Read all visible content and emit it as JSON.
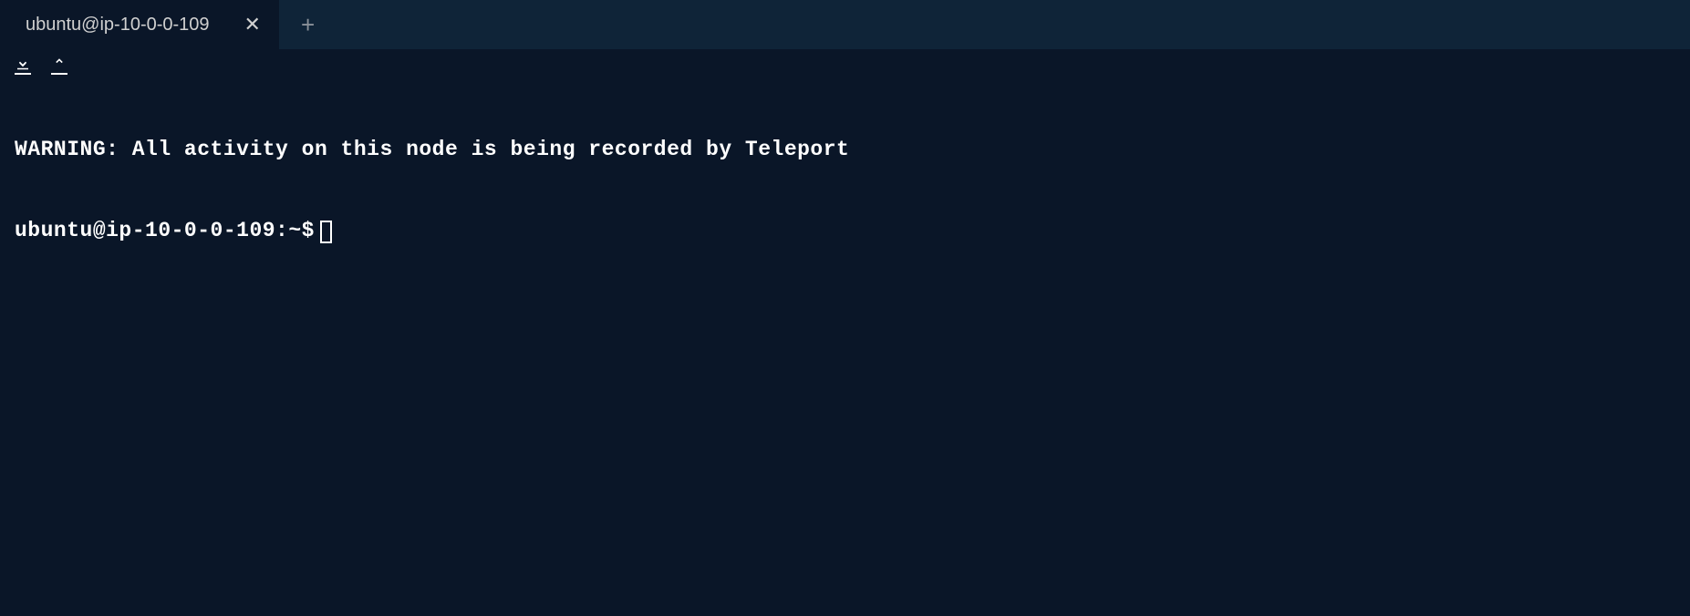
{
  "tabs": {
    "active": {
      "title": "ubuntu@ip-10-0-0-109"
    }
  },
  "terminal": {
    "warning": "WARNING: All activity on this node is being recorded by Teleport",
    "prompt": "ubuntu@ip-10-0-0-109:~$"
  }
}
